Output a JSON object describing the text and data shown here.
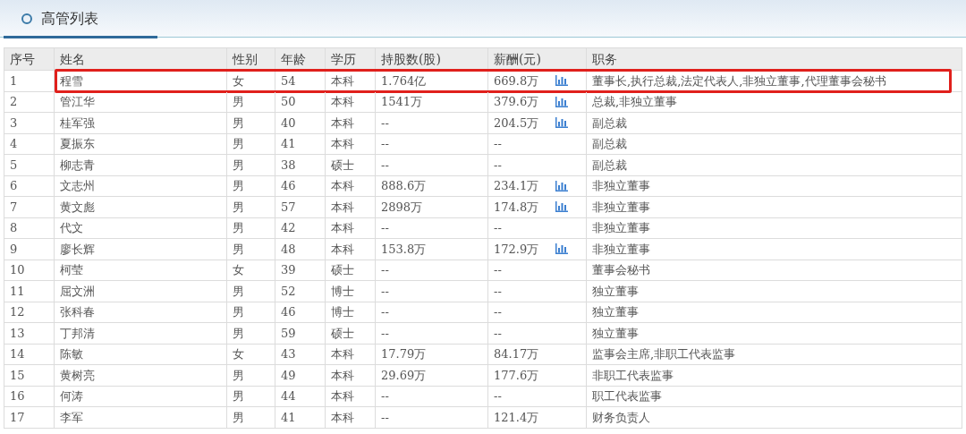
{
  "panel": {
    "title": "高管列表"
  },
  "table": {
    "columns": [
      "序号",
      "姓名",
      "性别",
      "年龄",
      "学历",
      "持股数(股)",
      "薪酬(元)",
      "职务"
    ],
    "rows": [
      {
        "index": "1",
        "name": "程雪",
        "gender": "女",
        "age": "54",
        "education": "本科",
        "shares": "1.764亿",
        "salary": "669.8万",
        "salary_chart": true,
        "position": "董事长,执行总裁,法定代表人,非独立董事,代理董事会秘书",
        "highlighted": true
      },
      {
        "index": "2",
        "name": "管江华",
        "gender": "男",
        "age": "50",
        "education": "本科",
        "shares": "1541万",
        "salary": "379.6万",
        "salary_chart": true,
        "position": "总裁,非独立董事",
        "highlighted": false
      },
      {
        "index": "3",
        "name": "桂军强",
        "gender": "男",
        "age": "40",
        "education": "本科",
        "shares": "--",
        "salary": "204.5万",
        "salary_chart": true,
        "position": "副总裁",
        "highlighted": false
      },
      {
        "index": "4",
        "name": "夏振东",
        "gender": "男",
        "age": "41",
        "education": "本科",
        "shares": "--",
        "salary": "--",
        "salary_chart": false,
        "position": "副总裁",
        "highlighted": false
      },
      {
        "index": "5",
        "name": "柳志青",
        "gender": "男",
        "age": "38",
        "education": "硕士",
        "shares": "--",
        "salary": "--",
        "salary_chart": false,
        "position": "副总裁",
        "highlighted": false
      },
      {
        "index": "6",
        "name": "文志州",
        "gender": "男",
        "age": "46",
        "education": "本科",
        "shares": "888.6万",
        "salary": "234.1万",
        "salary_chart": true,
        "position": "非独立董事",
        "highlighted": false
      },
      {
        "index": "7",
        "name": "黄文彪",
        "gender": "男",
        "age": "57",
        "education": "本科",
        "shares": "2898万",
        "salary": "174.8万",
        "salary_chart": true,
        "position": "非独立董事",
        "highlighted": false
      },
      {
        "index": "8",
        "name": "代文",
        "gender": "男",
        "age": "42",
        "education": "本科",
        "shares": "--",
        "salary": "--",
        "salary_chart": false,
        "position": "非独立董事",
        "highlighted": false
      },
      {
        "index": "9",
        "name": "廖长辉",
        "gender": "男",
        "age": "48",
        "education": "本科",
        "shares": "153.8万",
        "salary": "172.9万",
        "salary_chart": true,
        "position": "非独立董事",
        "highlighted": false
      },
      {
        "index": "10",
        "name": "柯莹",
        "gender": "女",
        "age": "39",
        "education": "硕士",
        "shares": "--",
        "salary": "--",
        "salary_chart": false,
        "position": "董事会秘书",
        "highlighted": false
      },
      {
        "index": "11",
        "name": "屈文洲",
        "gender": "男",
        "age": "52",
        "education": "博士",
        "shares": "--",
        "salary": "--",
        "salary_chart": false,
        "position": "独立董事",
        "highlighted": false
      },
      {
        "index": "12",
        "name": "张科春",
        "gender": "男",
        "age": "46",
        "education": "博士",
        "shares": "--",
        "salary": "--",
        "salary_chart": false,
        "position": "独立董事",
        "highlighted": false
      },
      {
        "index": "13",
        "name": "丁邦清",
        "gender": "男",
        "age": "59",
        "education": "硕士",
        "shares": "--",
        "salary": "--",
        "salary_chart": false,
        "position": "独立董事",
        "highlighted": false
      },
      {
        "index": "14",
        "name": "陈敏",
        "gender": "女",
        "age": "43",
        "education": "本科",
        "shares": "17.79万",
        "salary": "84.17万",
        "salary_chart": false,
        "position": "监事会主席,非职工代表监事",
        "highlighted": false
      },
      {
        "index": "15",
        "name": "黄树亮",
        "gender": "男",
        "age": "49",
        "education": "本科",
        "shares": "29.69万",
        "salary": "177.6万",
        "salary_chart": false,
        "position": "非职工代表监事",
        "highlighted": false
      },
      {
        "index": "16",
        "name": "何涛",
        "gender": "男",
        "age": "44",
        "education": "本科",
        "shares": "--",
        "salary": "--",
        "salary_chart": false,
        "position": "职工代表监事",
        "highlighted": false
      },
      {
        "index": "17",
        "name": "李军",
        "gender": "男",
        "age": "41",
        "education": "本科",
        "shares": "--",
        "salary": "121.4万",
        "salary_chart": false,
        "position": "财务负责人",
        "highlighted": false
      }
    ]
  }
}
